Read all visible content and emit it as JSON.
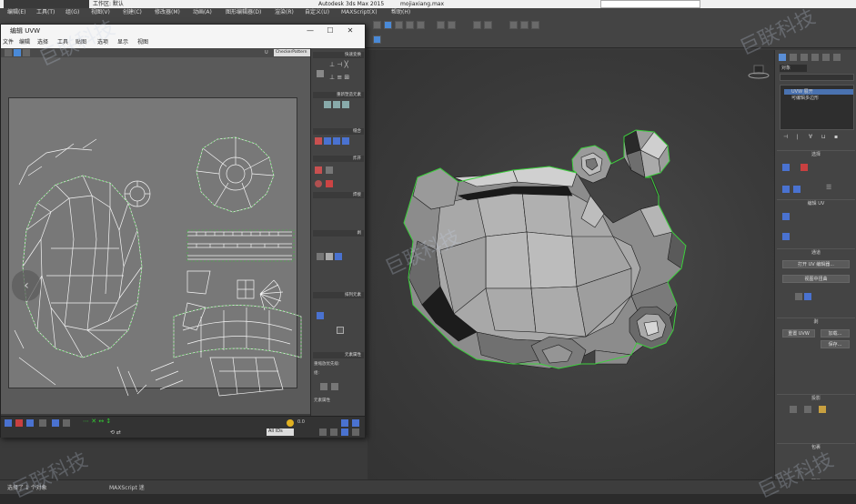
{
  "titlebar": {
    "workspace": "工作区: 默认",
    "app_title": "Autodesk 3ds Max 2015",
    "file_name": "mojiaxiang.max"
  },
  "menubar": [
    "编辑(E)",
    "工具(T)",
    "组(G)",
    "视图(V)",
    "创建(C)",
    "修改器(M)",
    "动画(A)",
    "图形编辑器(D)",
    "渲染(R)",
    "自定义(U)",
    "MAXScript(X)",
    "帮助(H)"
  ],
  "uv_editor": {
    "title": "编辑 UVW",
    "menu": [
      "文件",
      "编辑",
      "选择",
      "工具",
      "贴图",
      "选项",
      "显示",
      "视图"
    ],
    "channel_dropdown": "CheckerPattern",
    "side_headers": [
      "快速变换",
      "重新塑造元素",
      "缝合",
      "炸开",
      "焊接",
      "剥",
      "排列元素",
      "元素属性"
    ],
    "side_labels": [
      "重缩放元素",
      "元素属性",
      "重缩放优先级:",
      "组:"
    ],
    "status_value": "0.0",
    "axis_label": "U",
    "all_ids": "All IDs"
  },
  "command_panel": {
    "object_name": "对象",
    "modifier_stack": [
      "UVW 展开",
      "可编辑多边形"
    ],
    "sections": [
      "选择",
      "编辑 UV",
      "通道",
      "剥",
      "投影",
      "包裹",
      "配置"
    ],
    "buttons": [
      "打开 UV 编辑器...",
      "视图中扭曲",
      "重置 UVW",
      "保存...",
      "加载..."
    ]
  },
  "statusbar": {
    "left": "选择了 1 个对象",
    "script": "MAXScript 迷"
  },
  "watermark": "巨联科技"
}
